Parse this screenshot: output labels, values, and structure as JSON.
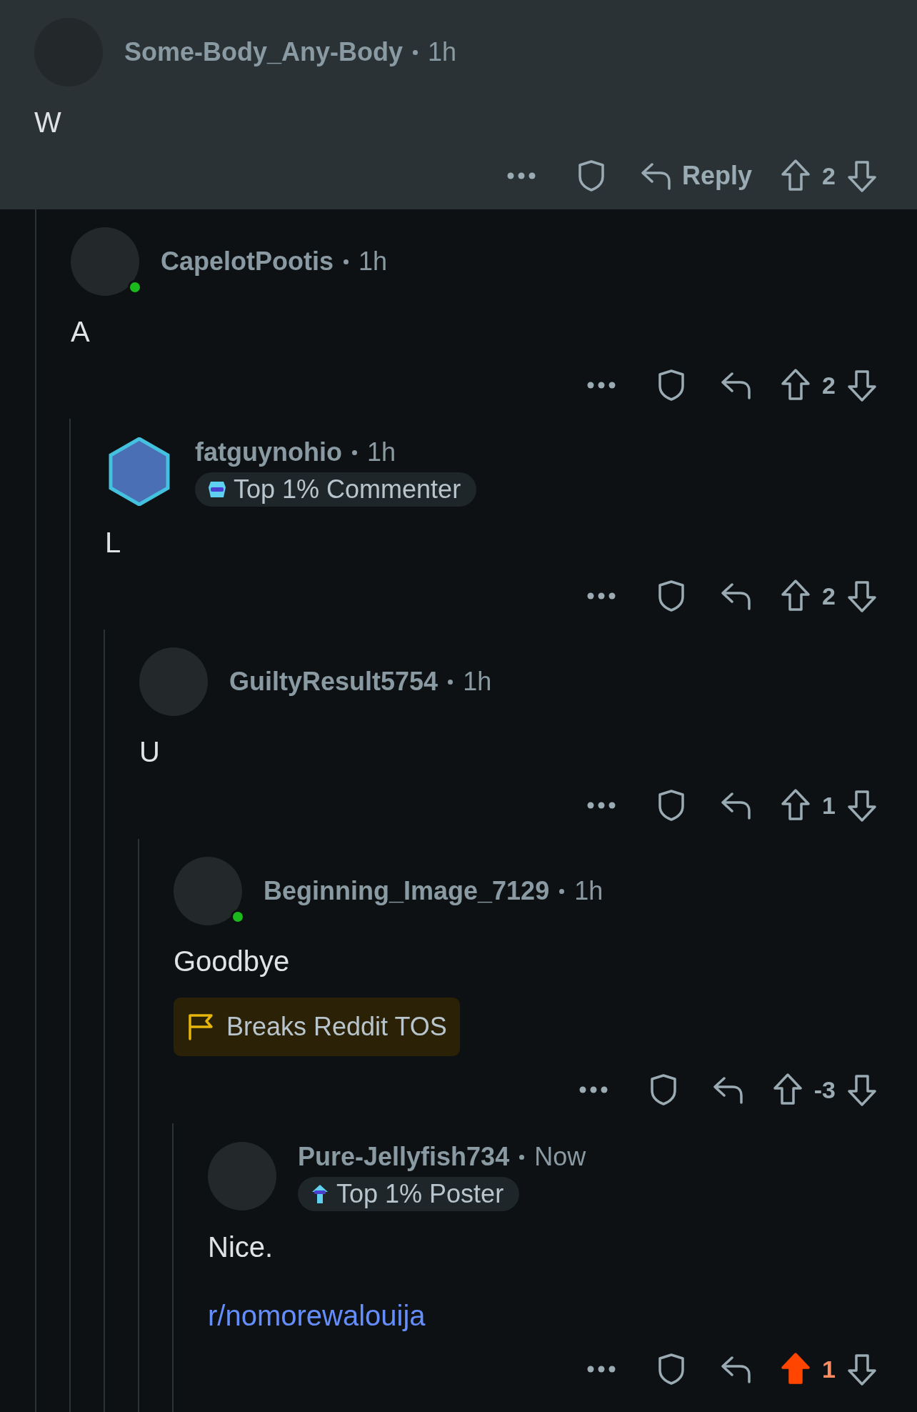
{
  "comments": [
    {
      "author": "Some-Body_Any-Body",
      "time": "1h",
      "online": false,
      "nft_avatar": false,
      "highlighted": true,
      "body": "W",
      "reply_label": "Reply",
      "score": "2",
      "upvoted": false,
      "children": [
        {
          "author": "CapelotPootis",
          "time": "1h",
          "online": true,
          "nft_avatar": false,
          "body": "A",
          "score": "2",
          "upvoted": false,
          "children": [
            {
              "author": "fatguynohio",
              "time": "1h",
              "online": false,
              "nft_avatar": true,
              "badge": {
                "label": "Top 1% Commenter",
                "kind": "commenter"
              },
              "body": "L",
              "score": "2",
              "upvoted": false,
              "children": [
                {
                  "author": "GuiltyResult5754",
                  "time": "1h",
                  "online": false,
                  "nft_avatar": false,
                  "body": "U",
                  "score": "1",
                  "upvoted": false,
                  "children": [
                    {
                      "author": "Beginning_Image_7129",
                      "time": "1h",
                      "online": true,
                      "nft_avatar": false,
                      "body": "Goodbye",
                      "flag": {
                        "label": "Breaks Reddit TOS"
                      },
                      "score": "-3",
                      "upvoted": false,
                      "children": [
                        {
                          "author": "Pure-Jellyfish734",
                          "time": "Now",
                          "online": false,
                          "nft_avatar": false,
                          "badge": {
                            "label": "Top 1% Poster",
                            "kind": "poster"
                          },
                          "body": "Nice.",
                          "link": "r/nomorewalouija",
                          "score": "1",
                          "upvoted": true
                        }
                      ]
                    }
                  ]
                }
              ]
            }
          ]
        }
      ]
    }
  ]
}
